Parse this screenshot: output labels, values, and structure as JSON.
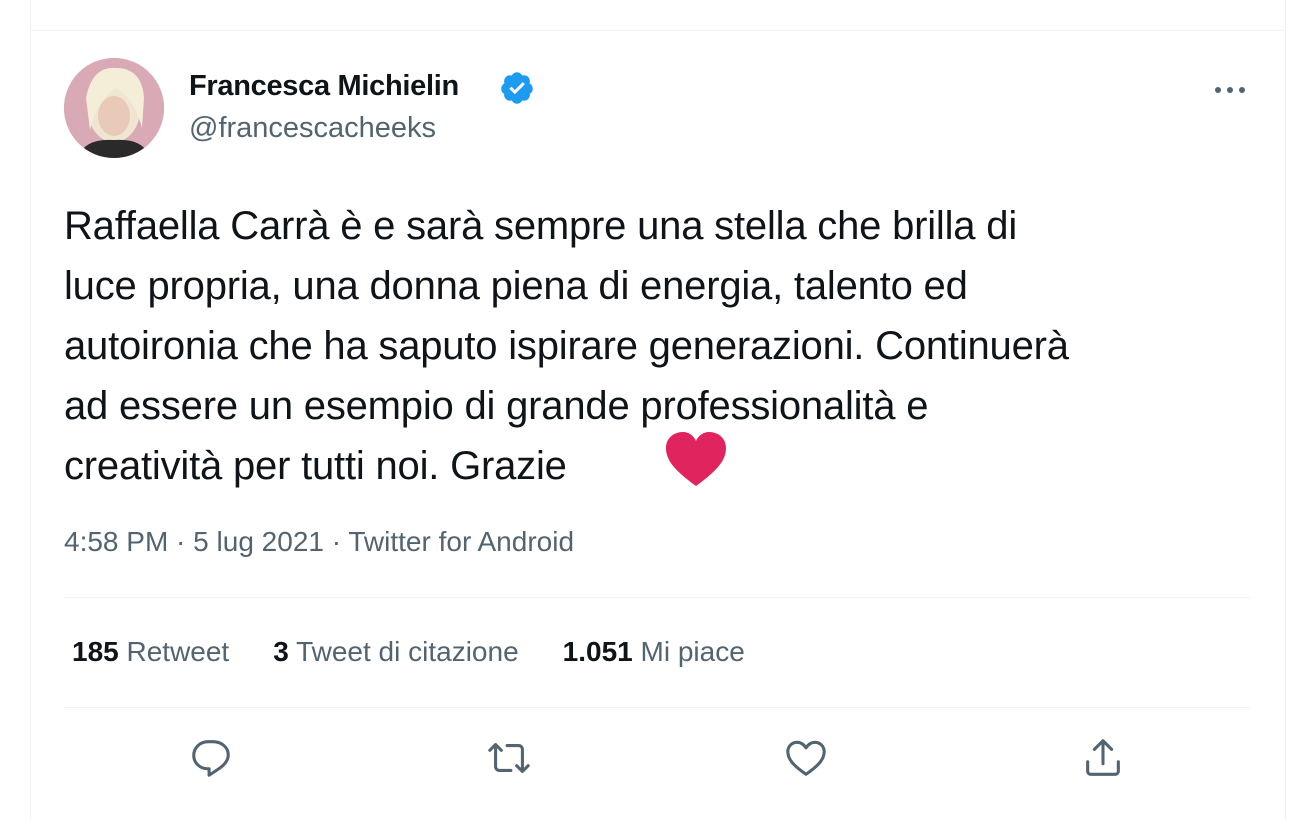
{
  "author": {
    "display_name": "Francesca Michielin",
    "handle": "@francescacheeks",
    "verified": true
  },
  "tweet": {
    "text": "Raffaella Carrà è e sarà sempre una stella che brilla di\nluce propria, una donna piena di energia, talento ed\nautoironia che ha saputo ispirare generazioni. Continuerà\nad essere un esempio di grande professionalità e\ncreatività per tutti noi. Grazie",
    "emoji": "red-heart-emoji",
    "time": "4:58 PM",
    "date": "5 lug 2021",
    "source": "Twitter for Android",
    "separator": " · "
  },
  "stats": {
    "retweets_count": "185",
    "retweets_label": " Retweet",
    "quotes_count": "3",
    "quotes_label": " Tweet di citazione",
    "likes_count": "1.051",
    "likes_label": " Mi piace"
  },
  "actions": [
    "reply-icon",
    "retweet-icon",
    "like-icon",
    "share-icon"
  ],
  "colors": {
    "verified": "#1d9bf0",
    "secondary_text": "#536471",
    "primary_text": "#0f1419",
    "heart": "#e0245e"
  }
}
